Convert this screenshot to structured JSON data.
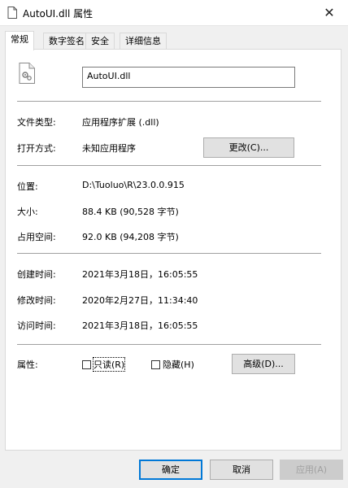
{
  "window": {
    "title": "AutoUI.dll 属性",
    "close_glyph": "✕"
  },
  "tabs": [
    {
      "label": "常规",
      "active": true
    },
    {
      "label": "数字签名",
      "active": false
    },
    {
      "label": "安全",
      "active": false
    },
    {
      "label": "详细信息",
      "active": false
    }
  ],
  "general": {
    "file_name": "AutoUI.dll",
    "file_type_label": "文件类型:",
    "file_type_value": "应用程序扩展 (.dll)",
    "open_with_label": "打开方式:",
    "open_with_value": "未知应用程序",
    "change_button": "更改(C)...",
    "location_label": "位置:",
    "location_value": "D:\\Tuoluo\\R\\23.0.0.915",
    "size_label": "大小:",
    "size_value": "88.4 KB (90,528 字节)",
    "size_on_disk_label": "占用空间:",
    "size_on_disk_value": "92.0 KB (94,208 字节)",
    "created_label": "创建时间:",
    "created_value": "2021年3月18日，16:05:55",
    "modified_label": "修改时间:",
    "modified_value": "2020年2月27日，11:34:40",
    "accessed_label": "访问时间:",
    "accessed_value": "2021年3月18日，16:05:55",
    "attributes_label": "属性:",
    "readonly_label": "只读(R)",
    "readonly_checked": false,
    "hidden_label": "隐藏(H)",
    "hidden_checked": false,
    "advanced_button": "高级(D)..."
  },
  "footer": {
    "ok_button": "确定",
    "cancel_button": "取消",
    "apply_button": "应用(A)"
  },
  "icons": {
    "title_icon": "document-icon",
    "file_icon": "dll-gear-file-icon",
    "close_icon": "close-icon"
  },
  "colors": {
    "focus_border": "#0078d7",
    "panel_bg": "#ffffff",
    "window_bg": "#f0f0f0"
  }
}
